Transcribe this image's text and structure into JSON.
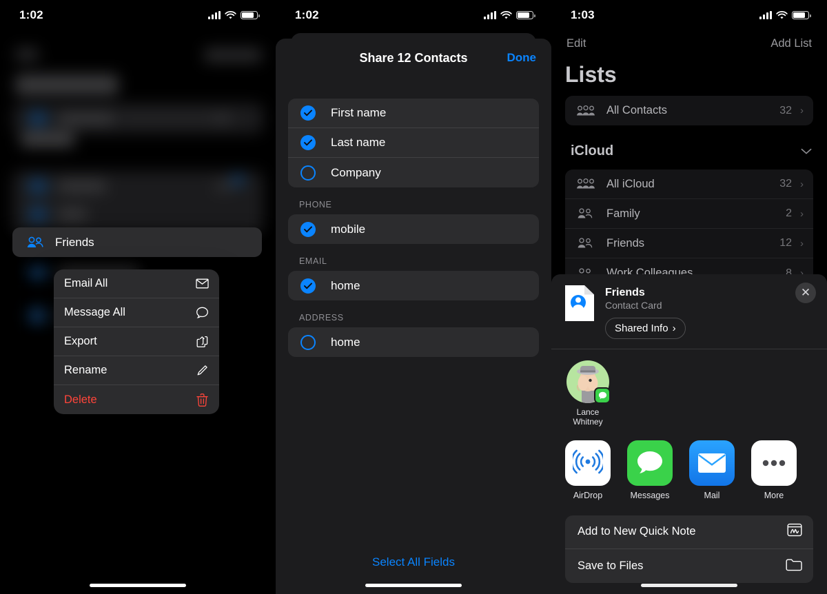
{
  "screens": [
    {
      "status": {
        "time": "1:02",
        "signal_icon": "cellular-bars-icon",
        "wifi_icon": "wifi-icon",
        "battery_icon": "battery-icon"
      },
      "selected_list": {
        "label": "Friends",
        "icon": "people-group-icon"
      },
      "context_menu": [
        {
          "label": "Email All",
          "icon": "envelope-icon",
          "destructive": false
        },
        {
          "label": "Message All",
          "icon": "speech-bubble-icon",
          "destructive": false
        },
        {
          "label": "Export",
          "icon": "share-up-icon",
          "destructive": false
        },
        {
          "label": "Rename",
          "icon": "pencil-icon",
          "destructive": false
        },
        {
          "label": "Delete",
          "icon": "trash-icon",
          "destructive": true
        }
      ]
    },
    {
      "status": {
        "time": "1:02"
      },
      "sheet": {
        "title": "Share 12 Contacts",
        "done_label": "Done",
        "select_all_label": "Select All Fields",
        "groups": [
          {
            "section": "",
            "rows": [
              {
                "label": "First name",
                "checked": true
              },
              {
                "label": "Last name",
                "checked": true
              },
              {
                "label": "Company",
                "checked": false
              }
            ]
          },
          {
            "section": "PHONE",
            "rows": [
              {
                "label": "mobile",
                "checked": true
              }
            ]
          },
          {
            "section": "EMAIL",
            "rows": [
              {
                "label": "home",
                "checked": true
              }
            ]
          },
          {
            "section": "ADDRESS",
            "rows": [
              {
                "label": "home",
                "checked": false
              }
            ]
          }
        ]
      }
    },
    {
      "status": {
        "time": "1:03"
      },
      "nav": {
        "edit_label": "Edit",
        "add_list_label": "Add List"
      },
      "page_title": "Lists",
      "all_contacts": {
        "label": "All Contacts",
        "count": "32",
        "icon": "people-group-icon"
      },
      "account": {
        "name": "iCloud",
        "collapse_icon": "chevron-down-icon"
      },
      "lists": [
        {
          "label": "All iCloud",
          "count": "32",
          "icon": "people-group-icon"
        },
        {
          "label": "Family",
          "count": "2",
          "icon": "people-icon"
        },
        {
          "label": "Friends",
          "count": "12",
          "icon": "people-icon"
        },
        {
          "label": "Work Colleagues",
          "count": "8",
          "icon": "people-icon"
        }
      ],
      "share_sheet": {
        "item_title": "Friends",
        "item_subtitle": "Contact Card",
        "shared_info_label": "Shared Info",
        "close_icon": "close-icon",
        "doc_icon": "contact-card-document-icon",
        "people": [
          {
            "name_line1": "Lance",
            "name_line2": "Whitney",
            "badge": "messages-badge-icon",
            "avatar": "memoji-avatar"
          }
        ],
        "apps": [
          {
            "label": "AirDrop",
            "icon": "airdrop-icon",
            "bg": "#ffffff"
          },
          {
            "label": "Messages",
            "icon": "messages-icon",
            "bg": "#3ad24a"
          },
          {
            "label": "Mail",
            "icon": "mail-icon",
            "bg": "#1f8fff"
          },
          {
            "label": "More",
            "icon": "more-dots-icon",
            "bg": "#ffffff"
          }
        ],
        "actions": [
          {
            "label": "Add to New Quick Note",
            "icon": "quick-note-icon"
          },
          {
            "label": "Save to Files",
            "icon": "folder-icon"
          }
        ]
      }
    }
  ],
  "colors": {
    "accent": "#0a84ff",
    "destructive": "#ff453a",
    "sheet_bg": "#1c1c1e",
    "row_bg": "#2c2c2e"
  }
}
